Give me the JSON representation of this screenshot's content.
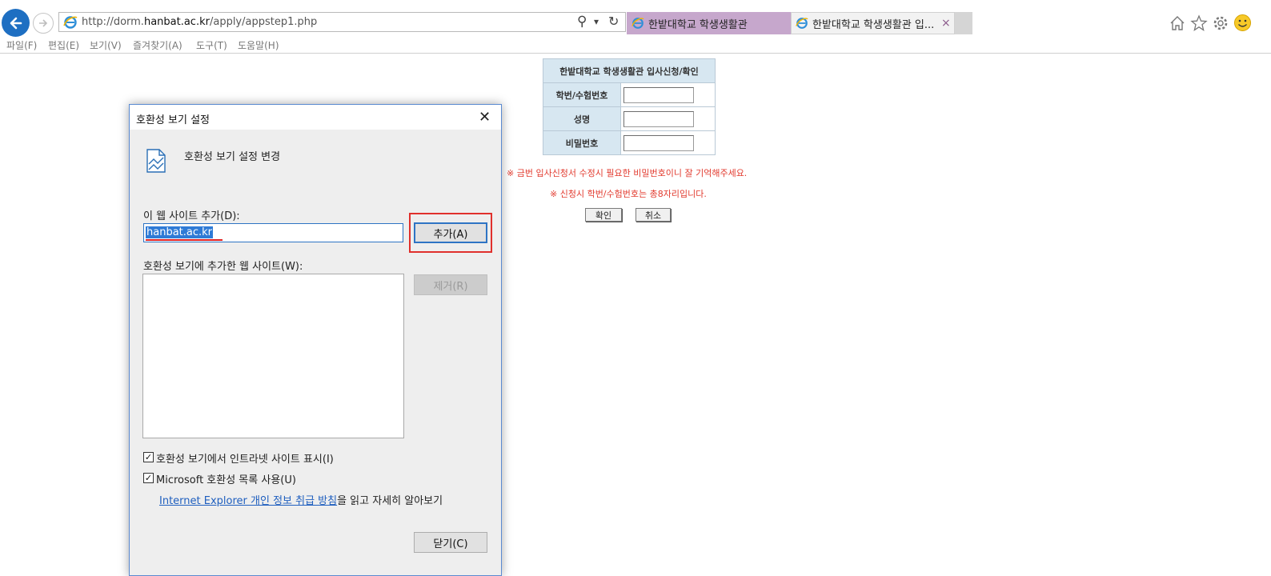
{
  "browser": {
    "url_prefix": "http://dorm.",
    "url_domain": "hanbat.ac.kr",
    "url_suffix": "/apply/appstep1.php",
    "search_glyph": "⚲",
    "dropdown_glyph": "▾",
    "refresh_glyph": "↻",
    "tabs": [
      {
        "label": "한밭대학교 학생생활관"
      },
      {
        "label": "한밭대학교 학생생활관 입..."
      }
    ],
    "tab_close": "×",
    "menu": [
      "파일(F)",
      "편집(E)",
      "보기(V)",
      "즐겨찾기(A)",
      "도구(T)",
      "도움말(H)"
    ],
    "toolbar_icons": [
      "home-icon",
      "favorites-star-icon",
      "settings-gear-icon",
      "smiley-feedback-icon"
    ]
  },
  "form": {
    "title": "한밭대학교 학생생활관 입사신청/확인",
    "fields": [
      {
        "label": "학번/수험번호",
        "value": ""
      },
      {
        "label": "성명",
        "value": ""
      },
      {
        "label": "비밀번호",
        "value": ""
      }
    ],
    "note1": "※ 금번 입사신청서 수정시 필요한 비밀번호이니 잘 기억해주세요.",
    "note2": "※ 신청시 학번/수험번호는 총8자리입니다.",
    "confirm_label": "확인",
    "cancel_label": "취소"
  },
  "dialog": {
    "title": "호환성 보기 설정",
    "close_glyph": "✕",
    "heading": "호환성 보기 설정 변경",
    "add_site_label": "이 웹 사이트 추가(D):",
    "add_site_value": "hanbat.ac.kr",
    "add_button": "추가(A)",
    "list_label": "호환성 보기에 추가한 웹 사이트(W):",
    "remove_button": "제거(R)",
    "checkbox_intranet": "호환성 보기에서 인트라넷 사이트 표시(I)",
    "checkbox_intranet_checked": true,
    "checkbox_mslist": "Microsoft 호환성 목록 사용(U)",
    "checkbox_mslist_checked": true,
    "check_glyph": "✓",
    "privacy_link": "Internet Explorer 개인 정보 취급 방침",
    "privacy_suffix": "을 읽고 자세히 알아보기",
    "close_button": "닫기(C)"
  }
}
